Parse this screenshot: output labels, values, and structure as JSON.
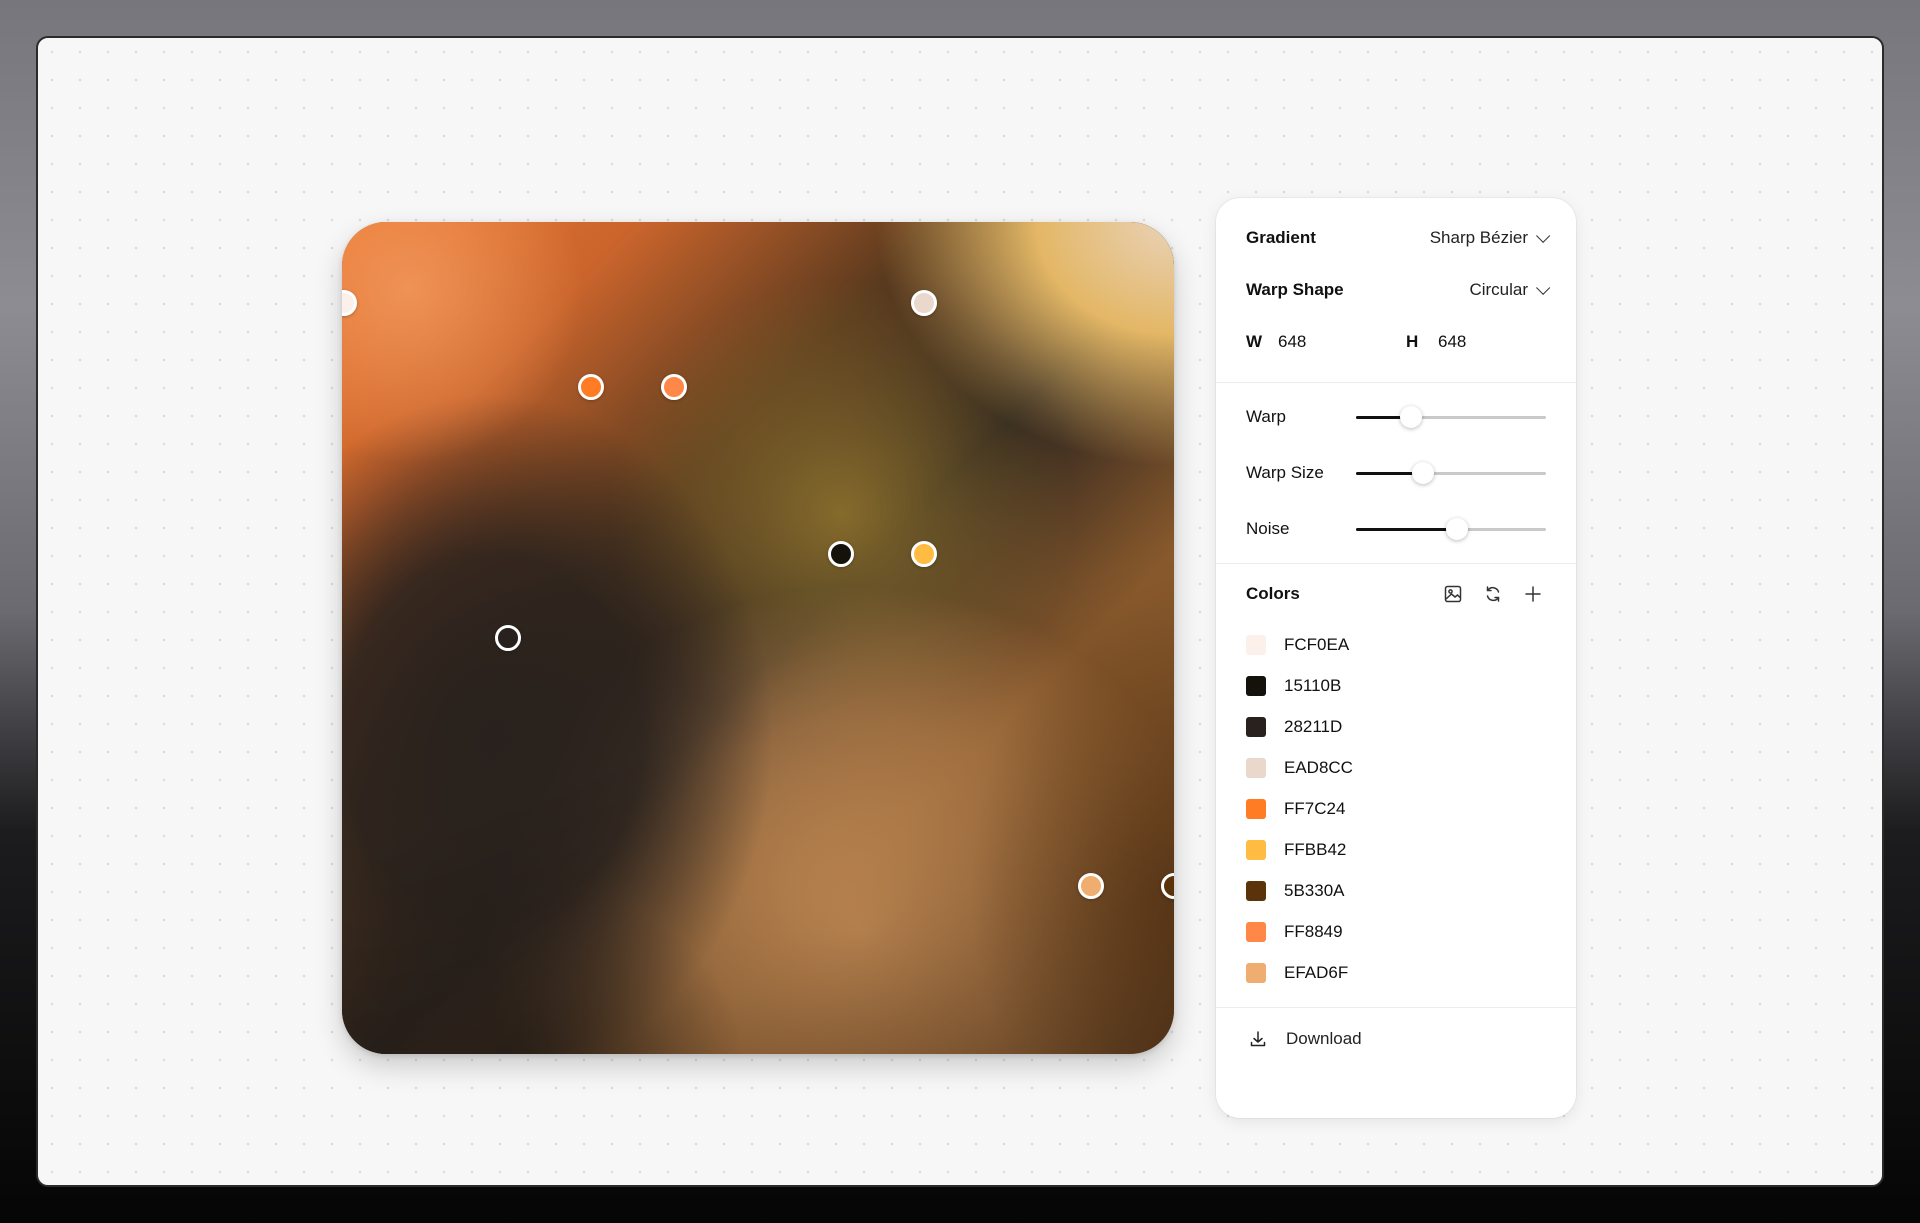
{
  "panel": {
    "gradient": {
      "label": "Gradient",
      "value": "Sharp Bézier"
    },
    "warp_shape": {
      "label": "Warp Shape",
      "value": "Circular"
    },
    "size": {
      "w_label": "W",
      "w_value": "648",
      "h_label": "H",
      "h_value": "648"
    },
    "sliders": [
      {
        "label": "Warp",
        "value": 0.29
      },
      {
        "label": "Warp Size",
        "value": 0.35
      },
      {
        "label": "Noise",
        "value": 0.53
      }
    ],
    "colors_label": "Colors",
    "colors": [
      {
        "hex": "FCF0EA",
        "swatch": "#FCF0EA"
      },
      {
        "hex": "15110B",
        "swatch": "#15110B"
      },
      {
        "hex": "28211D",
        "swatch": "#28211D"
      },
      {
        "hex": "EAD8CC",
        "swatch": "#EAD8CC"
      },
      {
        "hex": "FF7C24",
        "swatch": "#FF7C24"
      },
      {
        "hex": "FFBB42",
        "swatch": "#FFBB42"
      },
      {
        "hex": "5B330A",
        "swatch": "#5B330A"
      },
      {
        "hex": "FF8849",
        "swatch": "#FF8849"
      },
      {
        "hex": "EFAD6F",
        "swatch": "#EFAD6F"
      }
    ],
    "download_label": "Download"
  },
  "canvas": {
    "control_points": [
      {
        "color": "#FCF0EA"
      },
      {
        "color": "#EAD8CC"
      },
      {
        "color": "#FF7C24"
      },
      {
        "color": "#FF8849"
      },
      {
        "color": "#15110B"
      },
      {
        "color": "#FFBB42"
      },
      {
        "color": "#28211D"
      },
      {
        "color": "#EFAD6F"
      },
      {
        "color": "#5B330A"
      }
    ]
  }
}
